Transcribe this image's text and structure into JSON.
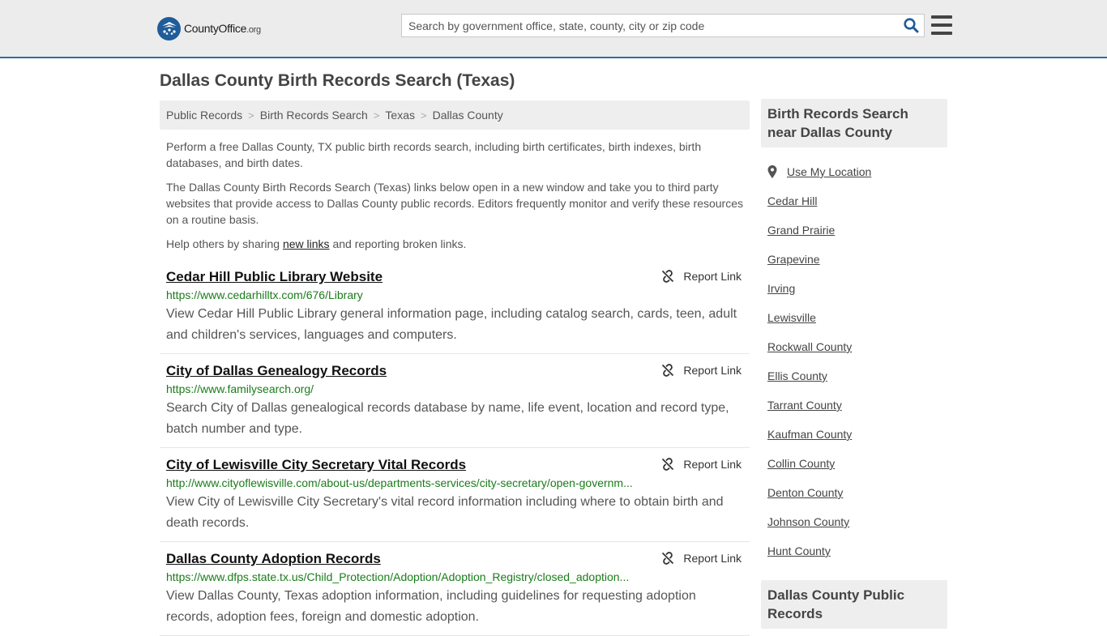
{
  "header": {
    "logo_text": "CountyOffice",
    "logo_tld": ".org",
    "search_placeholder": "Search by government office, state, county, city or zip code"
  },
  "page": {
    "title": "Dallas County Birth Records Search (Texas)"
  },
  "breadcrumb": [
    "Public Records",
    "Birth Records Search",
    "Texas",
    "Dallas County"
  ],
  "intro": {
    "p1": "Perform a free Dallas County, TX public birth records search, including birth certificates, birth indexes, birth databases, and birth dates.",
    "p2": "The Dallas County Birth Records Search (Texas) links below open in a new window and take you to third party websites that provide access to Dallas County public records. Editors frequently monitor and verify these resources on a routine basis.",
    "p3_before": "Help others by sharing ",
    "p3_link": "new links",
    "p3_after": " and reporting broken links."
  },
  "report_label": "Report Link",
  "links": [
    {
      "title": "Cedar Hill Public Library Website",
      "url": "https://www.cedarhilltx.com/676/Library",
      "desc": "View Cedar Hill Public Library general information page, including catalog search, cards, teen, adult and children's services, languages and computers."
    },
    {
      "title": "City of Dallas Genealogy Records",
      "url": "https://www.familysearch.org/",
      "desc": "Search City of Dallas genealogical records database by name, life event, location and record type, batch number and type."
    },
    {
      "title": "City of Lewisville City Secretary Vital Records",
      "url": "http://www.cityoflewisville.com/about-us/departments-services/city-secretary/open-governm...",
      "desc": "View City of Lewisville City Secretary's vital record information including where to obtain birth and death records."
    },
    {
      "title": "Dallas County Adoption Records",
      "url": "https://www.dfps.state.tx.us/Child_Protection/Adoption/Adoption_Registry/closed_adoption...",
      "desc": "View Dallas County, Texas adoption information, including guidelines for requesting adoption records, adoption fees, foreign and domestic adoption."
    }
  ],
  "sidebar": {
    "heading": "Birth Records Search near Dallas County",
    "use_location": "Use My Location",
    "items": [
      "Cedar Hill",
      "Grand Prairie",
      "Grapevine",
      "Irving",
      "Lewisville",
      "Rockwall County",
      "Ellis County",
      "Tarrant County",
      "Kaufman County",
      "Collin County",
      "Denton County",
      "Johnson County",
      "Hunt County"
    ],
    "heading2": "Dallas County Public Records"
  }
}
